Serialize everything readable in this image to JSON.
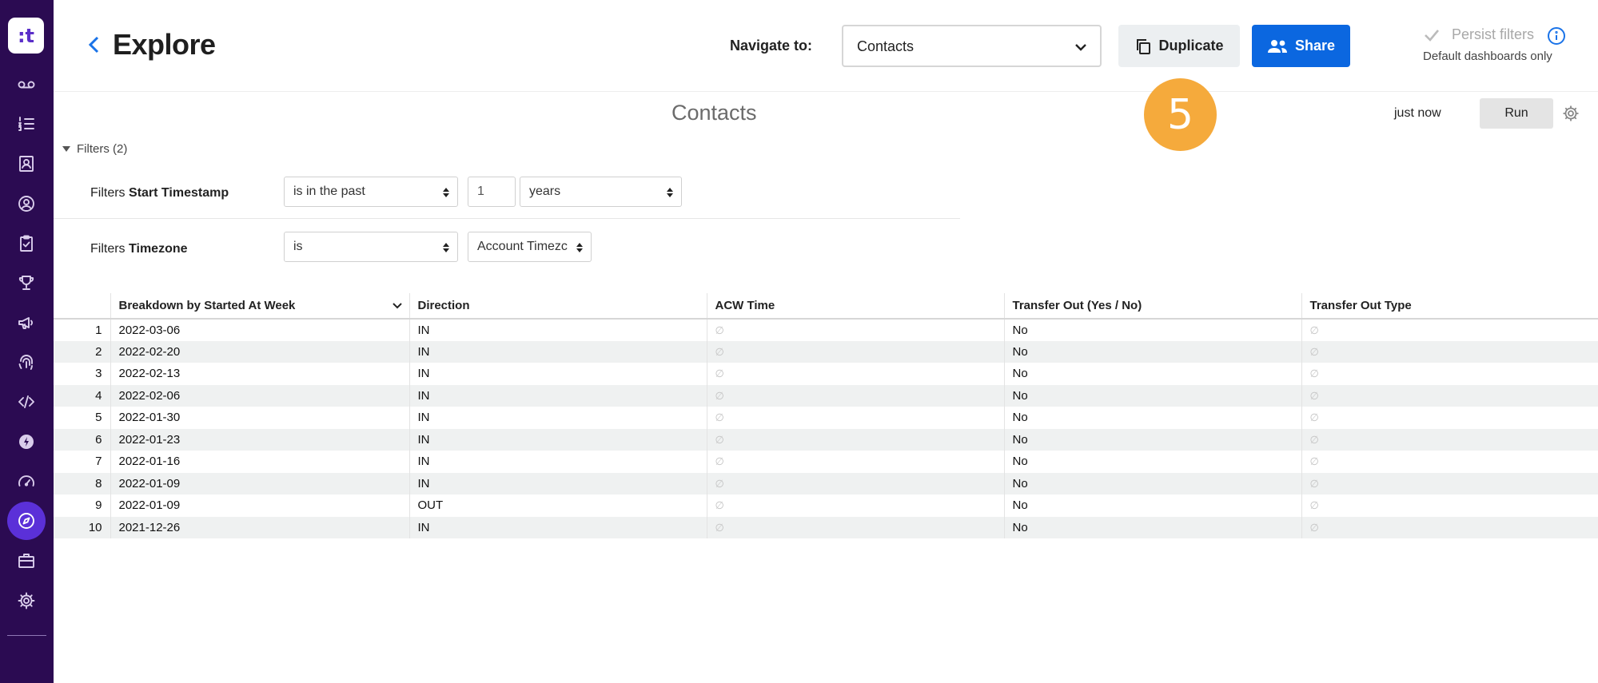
{
  "sidebar": {
    "logo_text": ":t",
    "items": [
      {
        "icon": "voicemail-icon"
      },
      {
        "icon": "list-numbered-icon"
      },
      {
        "icon": "contact-card-icon"
      },
      {
        "icon": "user-circle-icon"
      },
      {
        "icon": "clipboard-check-icon"
      },
      {
        "icon": "trophy-icon"
      },
      {
        "icon": "megaphone-icon"
      },
      {
        "icon": "fingerprint-icon"
      },
      {
        "icon": "code-icon"
      },
      {
        "icon": "lightning-icon"
      },
      {
        "icon": "speedometer-icon"
      },
      {
        "icon": "compass-icon",
        "active": true
      },
      {
        "icon": "briefcase-icon"
      },
      {
        "icon": "gear-icon"
      }
    ],
    "active_color": "#5b30d8",
    "background": "#2b0b52"
  },
  "header": {
    "title": "Explore",
    "navigate_label": "Navigate to:",
    "navigate_value": "Contacts",
    "duplicate_label": "Duplicate",
    "share_label": "Share",
    "persist_label": "Persist filters",
    "persist_sub": "Default dashboards only",
    "share_color": "#0b67e0"
  },
  "query": {
    "title": "Contacts",
    "badge": "5",
    "last_run": "just now",
    "run_label": "Run"
  },
  "filters": {
    "toggle_label": "Filters (2)",
    "rows": [
      {
        "prefix": "Filters",
        "field": "Start Timestamp",
        "operator": "is in the past",
        "number": "1",
        "unit": "years"
      },
      {
        "prefix": "Filters",
        "field": "Timezone",
        "operator": "is",
        "value": "Account Timezc"
      }
    ]
  },
  "table": {
    "columns": [
      "Breakdown by Started At Week",
      "Direction",
      "ACW Time",
      "Transfer Out (Yes / No)",
      "Transfer Out Type"
    ],
    "null_symbol": "∅",
    "rows": [
      {
        "n": "1",
        "week": "2022-03-06",
        "direction": "IN",
        "transfer": "No"
      },
      {
        "n": "2",
        "week": "2022-02-20",
        "direction": "IN",
        "transfer": "No"
      },
      {
        "n": "3",
        "week": "2022-02-13",
        "direction": "IN",
        "transfer": "No"
      },
      {
        "n": "4",
        "week": "2022-02-06",
        "direction": "IN",
        "transfer": "No"
      },
      {
        "n": "5",
        "week": "2022-01-30",
        "direction": "IN",
        "transfer": "No"
      },
      {
        "n": "6",
        "week": "2022-01-23",
        "direction": "IN",
        "transfer": "No"
      },
      {
        "n": "7",
        "week": "2022-01-16",
        "direction": "IN",
        "transfer": "No"
      },
      {
        "n": "8",
        "week": "2022-01-09",
        "direction": "IN",
        "transfer": "No"
      },
      {
        "n": "9",
        "week": "2022-01-09",
        "direction": "OUT",
        "transfer": "No"
      },
      {
        "n": "10",
        "week": "2021-12-26",
        "direction": "IN",
        "transfer": "No"
      }
    ]
  }
}
